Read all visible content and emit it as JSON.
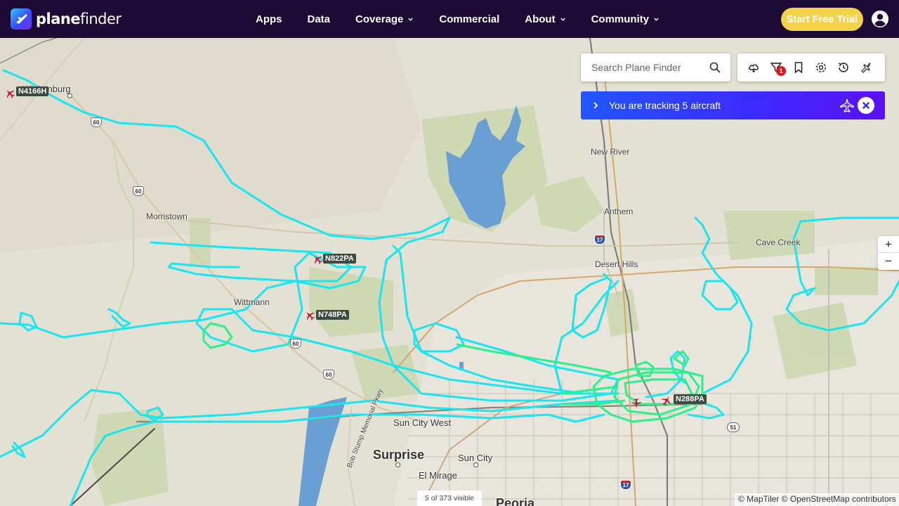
{
  "header": {
    "logo": {
      "brand_bold": "plane",
      "brand_light": "finder"
    },
    "nav": [
      {
        "label": "Apps",
        "dropdown": false
      },
      {
        "label": "Data",
        "dropdown": false
      },
      {
        "label": "Coverage",
        "dropdown": true
      },
      {
        "label": "Commercial",
        "dropdown": false
      },
      {
        "label": "About",
        "dropdown": true
      },
      {
        "label": "Community",
        "dropdown": true
      }
    ],
    "cta_label": "Start Free Trial",
    "account_icon": "account-circle-icon"
  },
  "search": {
    "placeholder": "Search Plane Finder",
    "icon": "search-icon"
  },
  "toolbar": {
    "tools": [
      "weather-icon",
      "filter-icon",
      "bookmark-icon",
      "settings-icon",
      "playback-icon",
      "aircraft-sparkle-icon"
    ],
    "filter_badge": "1"
  },
  "tracking": {
    "text": "You are tracking 5 aircraft",
    "icon": "plane-outline-icon"
  },
  "zoom": {
    "in": "+",
    "out": "−"
  },
  "places": {
    "wickenburg": "Wickenburg",
    "morristown": "Morristown",
    "wittmann": "Wittmann",
    "new_river": "New River",
    "anthem": "Anthem",
    "cave_creek": "Cave Creek",
    "desert_hills": "Desert Hills",
    "sun_city_west": "Sun City West",
    "surprise": "Surprise",
    "sun_city": "Sun City",
    "el_mirage": "El Mirage",
    "peoria": "Peoria",
    "bob_stump": "Bob Stump Memorial Pkwy"
  },
  "shields": {
    "us60": "60",
    "i17": "17",
    "r51": "51"
  },
  "aircraft": [
    {
      "callsign": "N4166H"
    },
    {
      "callsign": "N822PA"
    },
    {
      "callsign": "N748PA"
    },
    {
      "callsign": "N288PA"
    }
  ],
  "footer": {
    "visible_count": "5 of 373 visible",
    "attribution": "© MapTiler © OpenStreetMap contributors"
  },
  "colors": {
    "header_bg": "#1d0b36",
    "cta": "#f4d34a",
    "track_primary": "#19e6f0",
    "track_secondary": "#2ef08a",
    "aircraft": "#c8102e",
    "tracking_gradient_start": "#2156ff",
    "tracking_gradient_end": "#5b10f5"
  }
}
